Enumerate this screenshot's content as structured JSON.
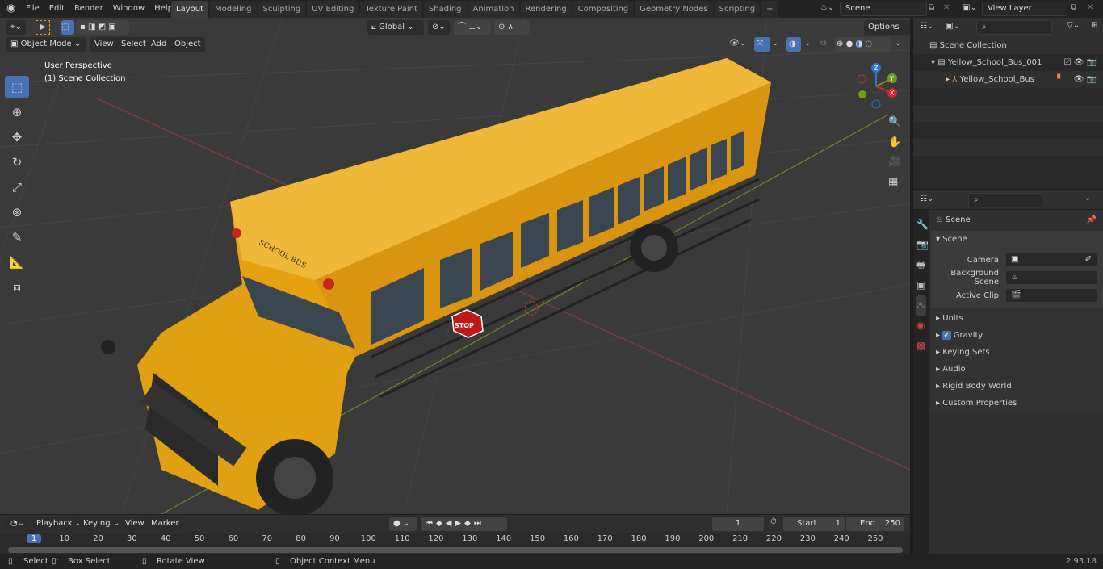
{
  "menu": [
    "File",
    "Edit",
    "Render",
    "Window",
    "Help"
  ],
  "workspaces": [
    "Layout",
    "Modeling",
    "Sculpting",
    "UV Editing",
    "Texture Paint",
    "Shading",
    "Animation",
    "Rendering",
    "Compositing",
    "Geometry Nodes",
    "Scripting"
  ],
  "active_workspace": "Layout",
  "scene_field": "Scene",
  "view_layer_field": "View Layer",
  "viewport": {
    "mode": "Object Mode",
    "menus": [
      "View",
      "Select",
      "Add",
      "Object"
    ],
    "transform_orientation": "Global",
    "options": "Options",
    "overlay_line1": "User Perspective",
    "overlay_line2": "(1) Scene Collection",
    "gizmo_axes": [
      "Z",
      "Y",
      "X"
    ]
  },
  "outliner": {
    "root": "Scene Collection",
    "collection": "Yellow_School_Bus_001",
    "object": "Yellow_School_Bus"
  },
  "properties": {
    "header": "Scene",
    "panel": "Scene",
    "fields": [
      {
        "label": "Camera",
        "value": ""
      },
      {
        "label": "Background Scene",
        "value": ""
      },
      {
        "label": "Active Clip",
        "value": ""
      }
    ],
    "sections": [
      "Units",
      "Gravity",
      "Keying Sets",
      "Audio",
      "Rigid Body World",
      "Custom Properties"
    ],
    "gravity_checked": true
  },
  "timeline": {
    "menus": [
      "Playback",
      "Keying",
      "View",
      "Marker"
    ],
    "current_frame": "1",
    "start_label": "Start",
    "start": "1",
    "end_label": "End",
    "end": "250",
    "ticks": [
      "1",
      "10",
      "20",
      "30",
      "40",
      "50",
      "60",
      "70",
      "80",
      "90",
      "100",
      "110",
      "120",
      "130",
      "140",
      "150",
      "160",
      "170",
      "180",
      "190",
      "200",
      "210",
      "220",
      "230",
      "240",
      "250"
    ]
  },
  "status": {
    "select": "Select",
    "box_select": "Box Select",
    "rotate": "Rotate View",
    "context": "Object Context Menu",
    "version": "2.93.18"
  },
  "bus": {
    "sign": "SCHOOL BUS",
    "stop": "STOP"
  },
  "colors": {
    "accent": "#4772b3",
    "bus": "#e9a514"
  }
}
